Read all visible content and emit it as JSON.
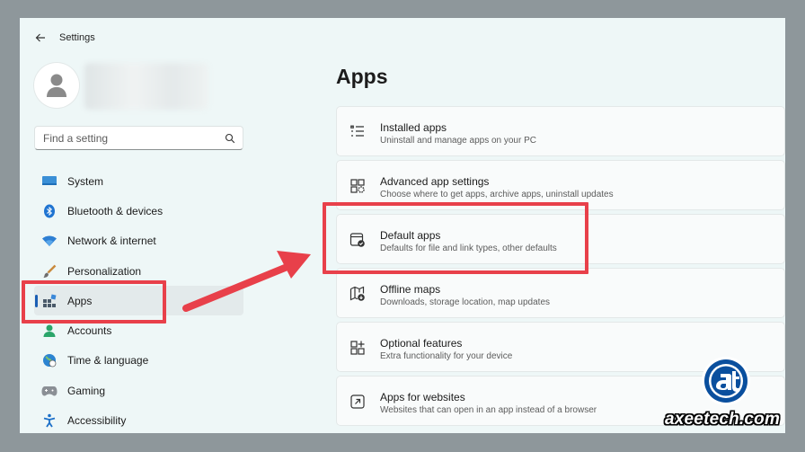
{
  "window": {
    "title": "Settings"
  },
  "search": {
    "placeholder": "Find a setting"
  },
  "sidebar": {
    "items": [
      {
        "label": "System",
        "icon": "monitor-icon"
      },
      {
        "label": "Bluetooth & devices",
        "icon": "bluetooth-icon"
      },
      {
        "label": "Network & internet",
        "icon": "wifi-icon"
      },
      {
        "label": "Personalization",
        "icon": "brush-icon"
      },
      {
        "label": "Apps",
        "icon": "apps-icon",
        "selected": true
      },
      {
        "label": "Accounts",
        "icon": "person-icon"
      },
      {
        "label": "Time & language",
        "icon": "globe-clock-icon"
      },
      {
        "label": "Gaming",
        "icon": "gamepad-icon"
      },
      {
        "label": "Accessibility",
        "icon": "accessibility-icon"
      }
    ]
  },
  "main": {
    "title": "Apps",
    "cards": [
      {
        "title": "Installed apps",
        "desc": "Uninstall and manage apps on your PC",
        "icon": "list-icon"
      },
      {
        "title": "Advanced app settings",
        "desc": "Choose where to get apps, archive apps, uninstall updates",
        "icon": "app-settings-icon"
      },
      {
        "title": "Default apps",
        "desc": "Defaults for file and link types, other defaults",
        "icon": "default-apps-icon"
      },
      {
        "title": "Offline maps",
        "desc": "Downloads, storage location, map updates",
        "icon": "map-download-icon"
      },
      {
        "title": "Optional features",
        "desc": "Extra functionality for your device",
        "icon": "add-features-icon"
      },
      {
        "title": "Apps for websites",
        "desc": "Websites that can open in an app instead of a browser",
        "icon": "open-link-icon"
      }
    ]
  },
  "annotation": {
    "color": "#e8404a"
  },
  "watermark": {
    "text": "axeetech.com"
  },
  "colors": {
    "accent": "#1a5fb4",
    "background": "#eef7f7"
  }
}
